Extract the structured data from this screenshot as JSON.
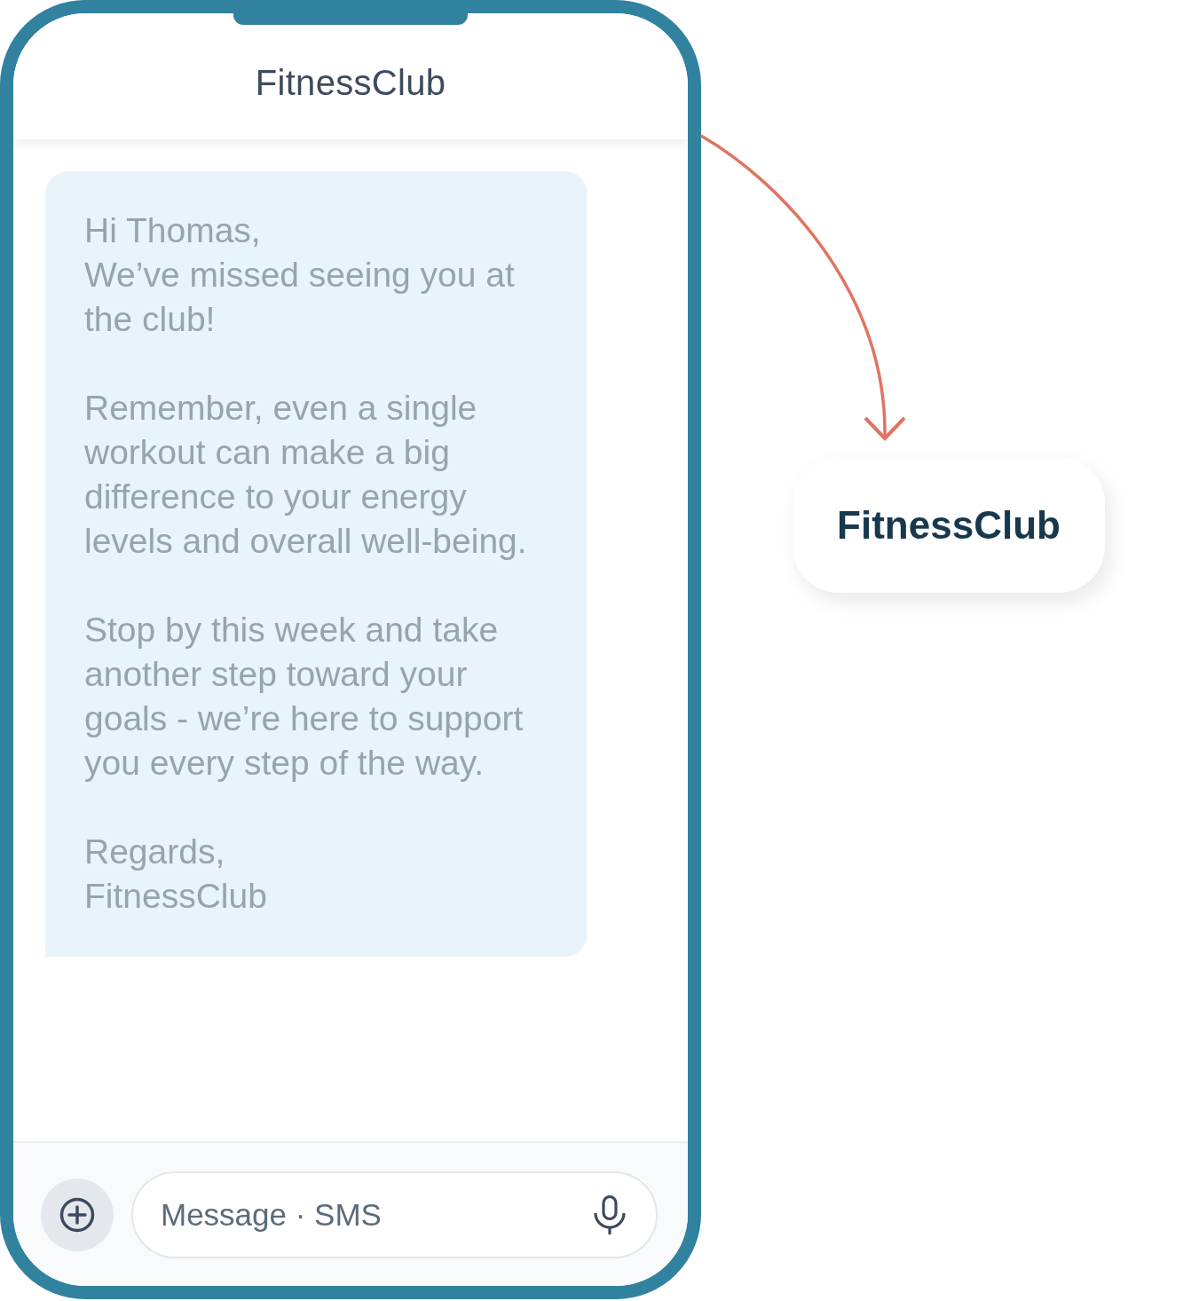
{
  "phone": {
    "contact_name": "FitnessClub",
    "message": {
      "paragraphs": [
        "Hi Thomas,\nWe’ve missed seeing you at the club!",
        "Remember, even a single workout can make a big difference to your energy levels and overall well-being.",
        "Stop by this week and take another step toward your goals - we’re here to support you every step of the way.",
        "Regards,\nFitnessClub"
      ]
    },
    "composer": {
      "placeholder": "Message · SMS"
    }
  },
  "sender_card": {
    "label": "FitnessClub"
  }
}
